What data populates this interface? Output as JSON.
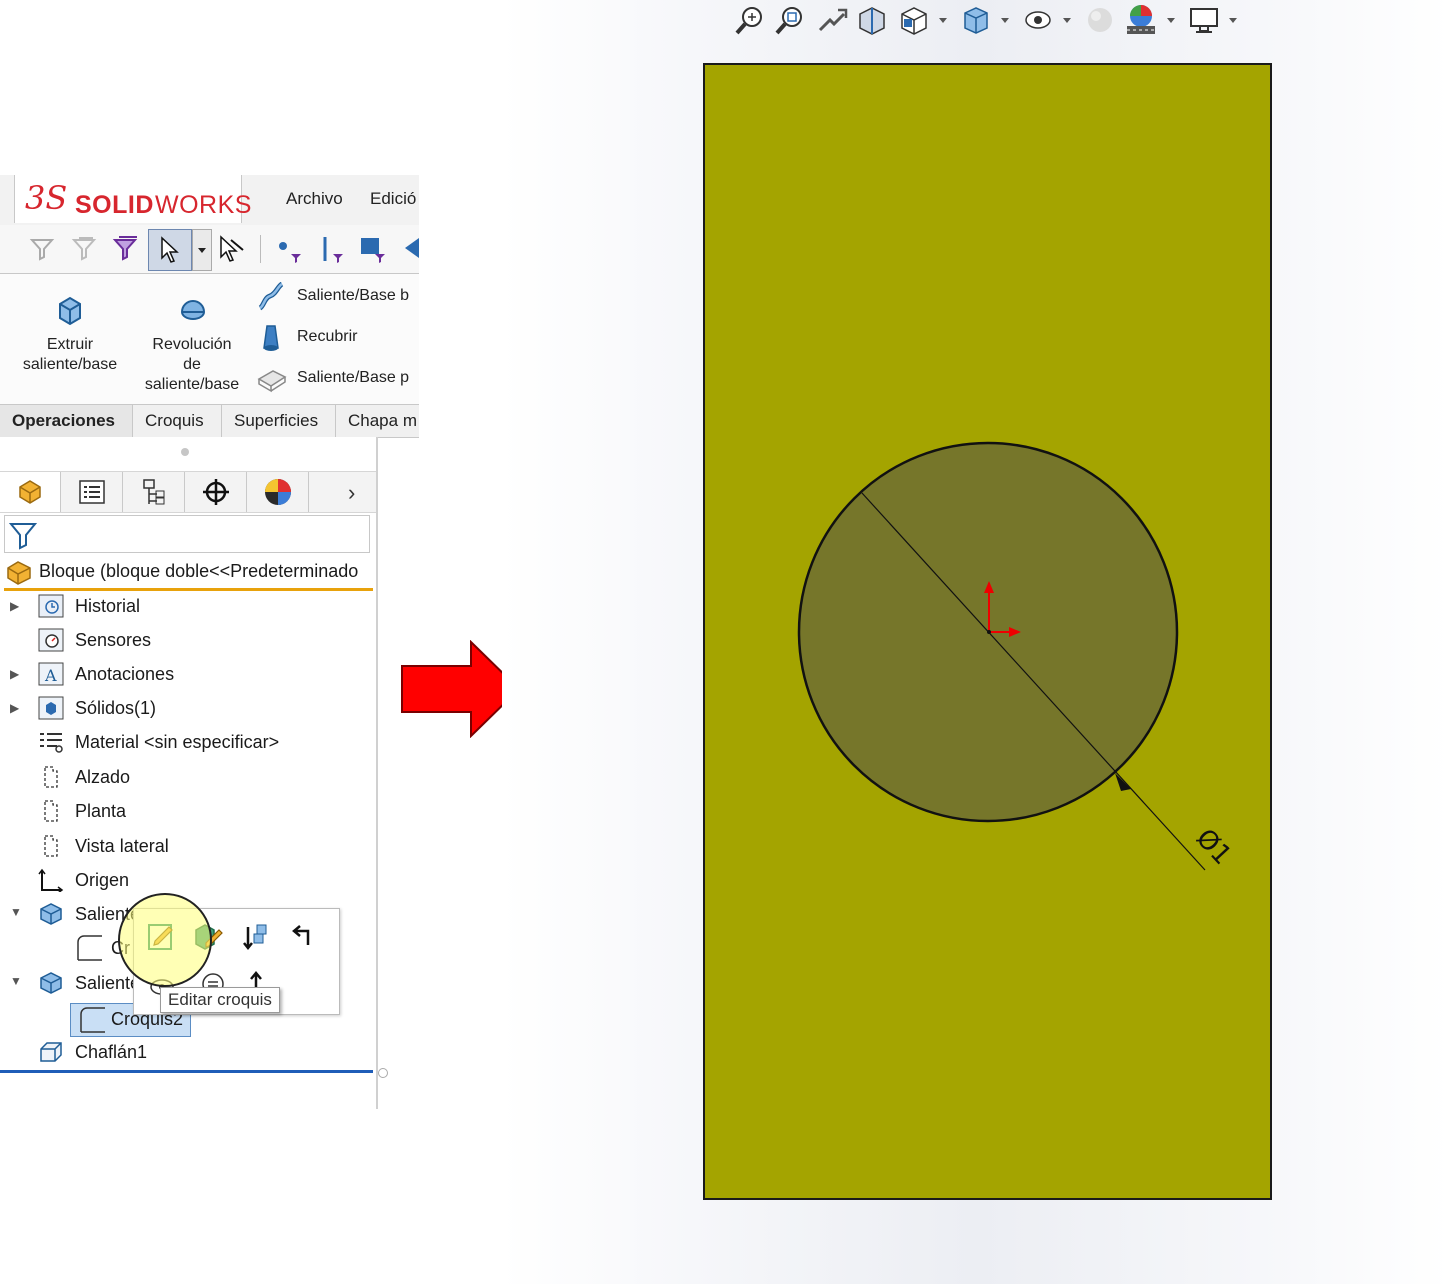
{
  "app": {
    "logo_prefix": "3S",
    "logo_solid": "SOLID",
    "logo_works": "WORKS",
    "menu": [
      "Archivo",
      "Edició"
    ]
  },
  "toolbar": {
    "icons": [
      "filter-icon",
      "filter-faded-icon",
      "filter-purple-icon",
      "select-arrow-icon",
      "dropdown-icon",
      "select-other-icon",
      "point-filter-icon",
      "line-filter-icon",
      "face-filter-icon",
      "more-filter-icon"
    ]
  },
  "ribbon": {
    "extrude_line1": "Extruir",
    "extrude_line2": "saliente/base",
    "revolve_line1": "Revolución",
    "revolve_line2": "de",
    "revolve_line3": "saliente/base",
    "sweep": "Saliente/Base b",
    "loft": "Recubrir",
    "boundary": "Saliente/Base p"
  },
  "tabs": [
    "Operaciones",
    "Croquis",
    "Superficies",
    "Chapa m"
  ],
  "feature_manager": {
    "part": "Bloque  (bloque doble<<Predeterminado",
    "items": [
      {
        "label": "Historial",
        "icon": "history-icon",
        "expander": "▶"
      },
      {
        "label": "Sensores",
        "icon": "sensor-icon",
        "expander": ""
      },
      {
        "label": "Anotaciones",
        "icon": "annotations-icon",
        "expander": "▶"
      },
      {
        "label": "Sólidos(1)",
        "icon": "solid-bodies-icon",
        "expander": "▶"
      },
      {
        "label": "Material <sin especificar>",
        "icon": "material-icon",
        "expander": ""
      },
      {
        "label": "Alzado",
        "icon": "plane-icon",
        "expander": ""
      },
      {
        "label": "Planta",
        "icon": "plane-icon",
        "expander": ""
      },
      {
        "label": "Vista lateral",
        "icon": "plane-icon",
        "expander": ""
      },
      {
        "label": "Origen",
        "icon": "origin-icon",
        "expander": ""
      },
      {
        "label": "Saliente",
        "icon": "extrude-feature-icon",
        "expander": "▼"
      },
      {
        "label": "Cr",
        "icon": "sketch-icon",
        "expander": ""
      },
      {
        "label": "Saliente",
        "icon": "extrude-feature-icon",
        "expander": "▼"
      },
      {
        "label": "Croquis2",
        "icon": "sketch-icon",
        "expander": ""
      },
      {
        "label": "Chaflán1",
        "icon": "chamfer-icon",
        "expander": ""
      }
    ]
  },
  "context_menu": {
    "tooltip": "Editar croquis"
  },
  "viewport": {
    "dimension_text": "Ø1",
    "face_color": "#a4a400",
    "circle_color": "#76762a",
    "arrow_color": "#ee0000"
  }
}
